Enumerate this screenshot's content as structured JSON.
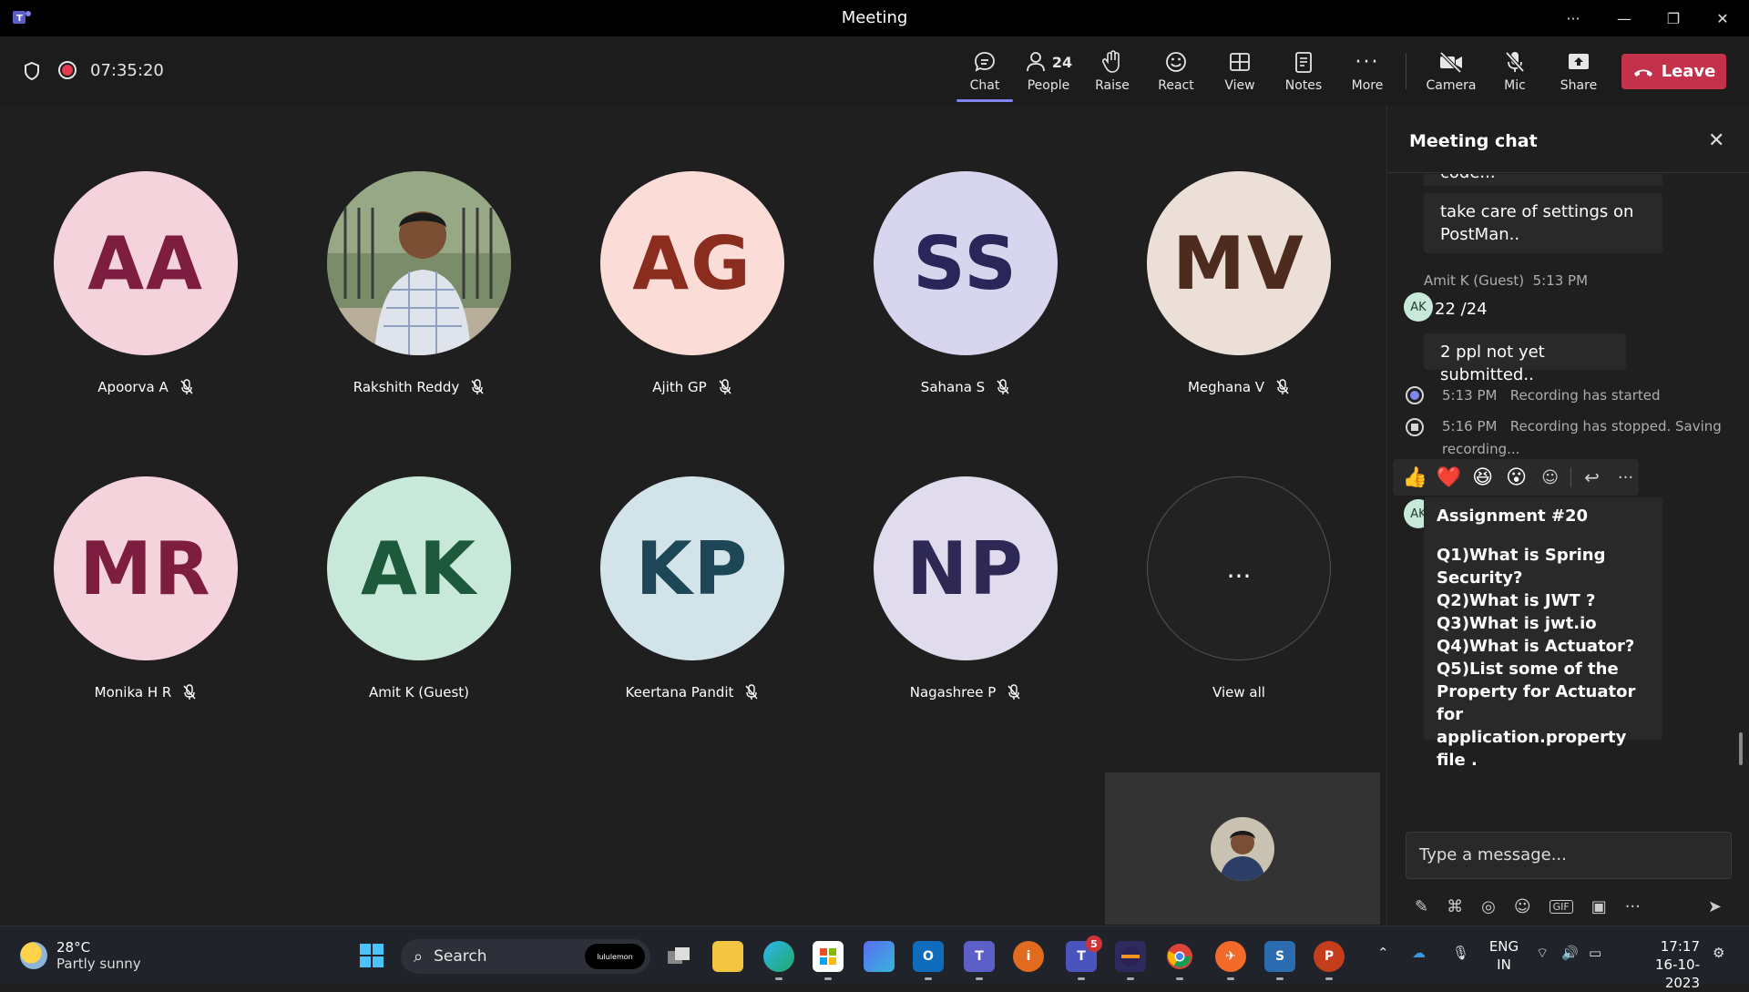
{
  "window": {
    "title": "Meeting"
  },
  "toolbar": {
    "timer": "07:35:20",
    "buttons": [
      {
        "label": "Chat"
      },
      {
        "label": "People",
        "count": "24"
      },
      {
        "label": "Raise"
      },
      {
        "label": "React"
      },
      {
        "label": "View"
      },
      {
        "label": "Notes"
      },
      {
        "label": "More"
      },
      {
        "label": "Camera"
      },
      {
        "label": "Mic"
      },
      {
        "label": "Share"
      }
    ],
    "leave_label": "Leave"
  },
  "participants": [
    {
      "initials": "AA",
      "name": "Apoorva A",
      "bg": "#f5d3dd",
      "fg": "#7d1d3f"
    },
    {
      "initials": "",
      "name": "Rakshith Reddy",
      "bg": "#6b7b5e",
      "fg": "#fff"
    },
    {
      "initials": "AG",
      "name": "Ajith GP",
      "bg": "#fbdcd6",
      "fg": "#8a2c1e"
    },
    {
      "initials": "SS",
      "name": "Sahana S",
      "bg": "#d8d6ee",
      "fg": "#2b2659"
    },
    {
      "initials": "MV",
      "name": "Meghana V",
      "bg": "#ebdfd8",
      "fg": "#4d2b1e"
    },
    {
      "initials": "MR",
      "name": "Monika H R",
      "bg": "#f5d3dd",
      "fg": "#7d1d3f"
    },
    {
      "initials": "AK",
      "name": "Amit K (Guest)",
      "bg": "#c8e8d9",
      "fg": "#1d5a3c"
    },
    {
      "initials": "KP",
      "name": "Keertana Pandit",
      "bg": "#d3e3ea",
      "fg": "#1d4656"
    },
    {
      "initials": "NP",
      "name": "Nagashree P",
      "bg": "#e0dced",
      "fg": "#2e2855"
    }
  ],
  "view_all": {
    "label": "View all",
    "icon": "..."
  },
  "chat": {
    "title": "Meeting chat",
    "partial_top": "code...",
    "msg_settings": "take care of settings on PostMan..",
    "sender": "Amit K (Guest)",
    "sender_time": "5:13 PM",
    "badge": "AK",
    "msg_count": "22 /24",
    "msg_pending": "2 ppl not yet submitted..",
    "sys_started_time": "5:13 PM",
    "sys_started_text": "Recording has started",
    "sys_stopped_time": "5:16 PM",
    "sys_stopped_text": "Recording has stopped. Saving recording...",
    "reactions": [
      "👍",
      "❤️",
      "😆",
      "😮"
    ],
    "assignment_title": "Assignment #20",
    "assignment_body": "Q1)What is Spring Security?\nQ2)What is JWT ?\nQ3)What is jwt.io\nQ4)What is Actuator?\nQ5)List some of the Property for Actuator for application.property file .",
    "compose_placeholder": "Type a message..."
  },
  "taskbar": {
    "weather_temp": "28°C",
    "weather_desc": "Partly sunny",
    "search_label": "Search",
    "search_brand": "lululemon",
    "teams_badge": "5",
    "lang_line1": "ENG",
    "lang_line2": "IN",
    "time": "17:17",
    "date": "16-10-2023"
  }
}
